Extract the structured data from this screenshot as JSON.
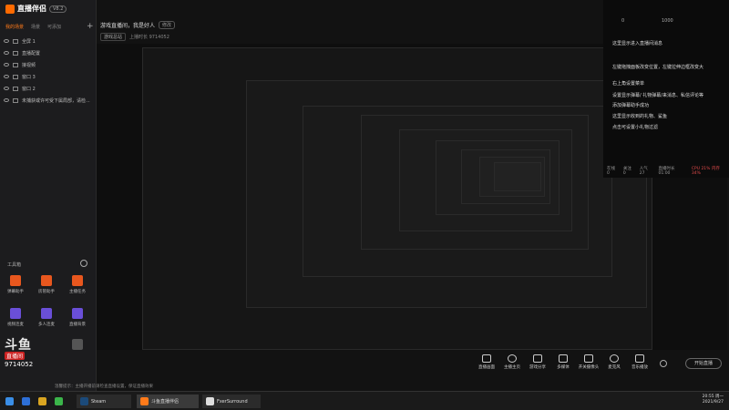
{
  "app": {
    "name": "直播伴侣",
    "version": "V8.2"
  },
  "sidebar": {
    "tabs": [
      "我的场景",
      "场景",
      "可添加"
    ],
    "sources": [
      "全屏 1",
      "直播配置",
      "接视频",
      "窗口 3",
      "窗口 2",
      "未捕获或许可受下属局部，请检..."
    ],
    "toolbox_label": "工具箱",
    "tools": [
      "弹幕助手",
      "房管助手",
      "主播任务",
      "视频连麦",
      "多人连麦",
      "直播背景",
      "",
      "",
      "",
      "",
      "",
      ""
    ]
  },
  "header": {
    "title": "游戏直播间，我是好人",
    "edit_label": "修改",
    "category": "游戏总站",
    "sub_info": "上播时长 9714052"
  },
  "right_panel": {
    "counts": [
      "0",
      "1000"
    ],
    "messages": [
      "这里显示进入直播间消息",
      "左键拖拽面板改变位置，左键拉伸边框改变大",
      "右上角设置菜单",
      "设置显示弹幕/  礼物弹幕/来消息、私信评论等",
      "添加弹幕助手成功",
      "这里显示收到的礼物、鲨鱼",
      "点击可设置小礼物过滤"
    ],
    "stats": [
      "在线 0",
      "关注 0",
      "人气 27",
      "直播时长 01:00",
      "CPU 21% 内存 34%"
    ]
  },
  "bottom_toolbar": {
    "items": [
      "直播画面",
      "主播主页",
      "游戏分享",
      "多媒体",
      "开关摄像头",
      "麦克风",
      "音乐播放"
    ],
    "start_label": "开始直播"
  },
  "watermark": {
    "logo": "斗鱼",
    "badge": "直播间",
    "room": "9714052"
  },
  "status_text": "温馨提示：主播开播前请检查直播设置，保证直播效果",
  "taskbar": {
    "apps": [
      "Steam",
      "斗鱼直播伴侣",
      "FxerSurround"
    ],
    "time": "20:55 周一",
    "date": "2021/9/27"
  },
  "colors": {
    "accent": "#ff7a1a",
    "background": "#121212",
    "panel": "#1c1c1e"
  }
}
